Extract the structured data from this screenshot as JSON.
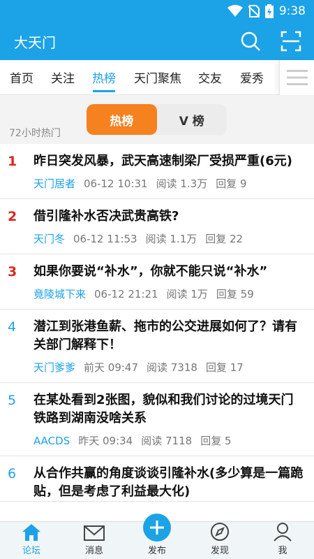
{
  "status": {
    "time": "9:38"
  },
  "appbar": {
    "title": "大天门",
    "search_icon": "search-icon",
    "scan_icon": "scan-icon"
  },
  "tabs": [
    {
      "label": "首页",
      "active": false
    },
    {
      "label": "关注",
      "active": false
    },
    {
      "label": "热榜",
      "active": true
    },
    {
      "label": "天门聚焦",
      "active": false
    },
    {
      "label": "交友",
      "active": false
    },
    {
      "label": "爱秀",
      "active": false
    }
  ],
  "segment": {
    "hot_label": "热榜",
    "v_label": "V 榜"
  },
  "section_label": "72小时热门",
  "posts": [
    {
      "rank": "1",
      "title": "昨日突发风暴，武天高速制梁厂受损严重(6元)",
      "author": "天门居者",
      "time": "06-12 10:31",
      "reads": "阅读 1.3万",
      "replies": "回复 9"
    },
    {
      "rank": "2",
      "title": "借引隆补水否决武贵高铁?",
      "author": "天门冬",
      "time": "06-12 11:53",
      "reads": "阅读 1.1万",
      "replies": "回复 22"
    },
    {
      "rank": "3",
      "title": "如果你要说“补水”，你就不能只说“补水”",
      "author": "竟陵城下来",
      "time": "06-12 21:21",
      "reads": "阅读 1万",
      "replies": "回复 59"
    },
    {
      "rank": "4",
      "title": "潜江到张港鱼薪、拖市的公交进展如何了？请有关部门解释下！",
      "author": "天门爹爹",
      "time": "前天 09:47",
      "reads": "阅读 7318",
      "replies": "回复 17"
    },
    {
      "rank": "5",
      "title": "在某处看到2张图，貌似和我们讨论的过境天门铁路到湖南没啥关系",
      "author": "AACDS",
      "time": "昨天 09:34",
      "reads": "阅读 7118",
      "replies": "回复 5"
    },
    {
      "rank": "6",
      "title": "从合作共赢的角度谈谈引隆补水(多少算是一篇跪贴，但是考虑了利益最大化)",
      "author": "",
      "time": "",
      "reads": "",
      "replies": ""
    }
  ],
  "bottom_nav": [
    {
      "label": "论坛",
      "icon": "home-icon",
      "active": true
    },
    {
      "label": "消息",
      "icon": "mail-icon",
      "active": false
    },
    {
      "label": "发布",
      "icon": "plus-icon",
      "active": false
    },
    {
      "label": "发现",
      "icon": "compass-icon",
      "active": false
    },
    {
      "label": "我",
      "icon": "user-icon",
      "active": false
    }
  ],
  "colors": {
    "primary": "#1ca2e6",
    "accent_orange": "#f5811f",
    "rank_hot": "#d9281e"
  }
}
